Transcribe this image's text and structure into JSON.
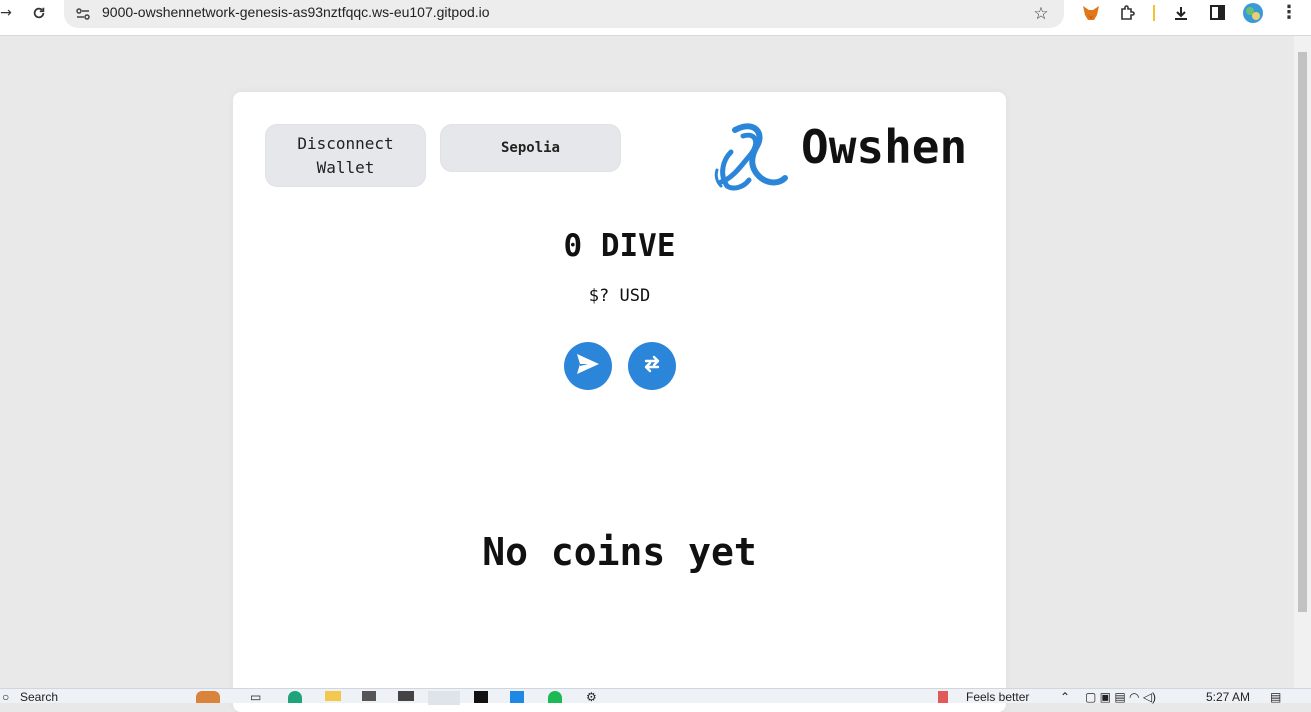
{
  "browser": {
    "url": "9000-owshennetwork-genesis-as93nztfqqc.ws-eu107.gitpod.io"
  },
  "app": {
    "disconnect_label": "Disconnect Wallet",
    "network_label": "Sepolia",
    "brand_name": "Owshen",
    "balance": "0 DIVE",
    "usd_value": "$? USD",
    "empty_message": "No coins yet",
    "accent_color": "#2b86d9"
  },
  "taskbar": {
    "search_label": "Search",
    "weather_label": "Feels better",
    "time": "5:27 AM"
  }
}
